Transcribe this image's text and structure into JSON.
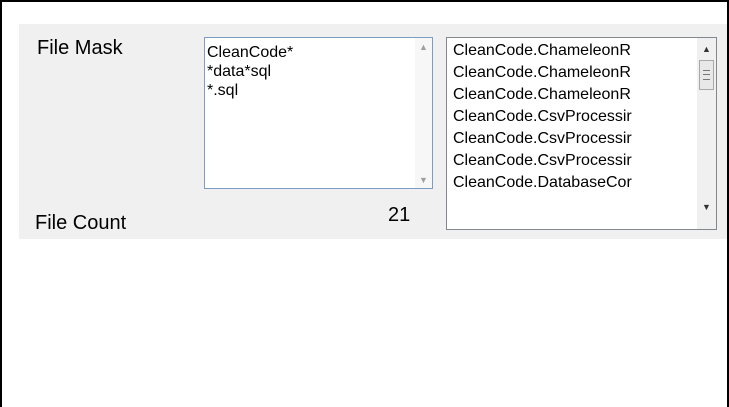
{
  "file_mask": {
    "label": "File Mask",
    "lines": [
      "CleanCode*",
      "*data*sql",
      "*.sql"
    ]
  },
  "file_count": {
    "label": "File Count",
    "value": "21"
  },
  "file_list": {
    "items": [
      "CleanCode.ChameleonR",
      "CleanCode.ChameleonR",
      "CleanCode.ChameleonR",
      "CleanCode.CsvProcessir",
      "CleanCode.CsvProcessir",
      "CleanCode.CsvProcessir",
      "CleanCode.DatabaseCor"
    ]
  }
}
